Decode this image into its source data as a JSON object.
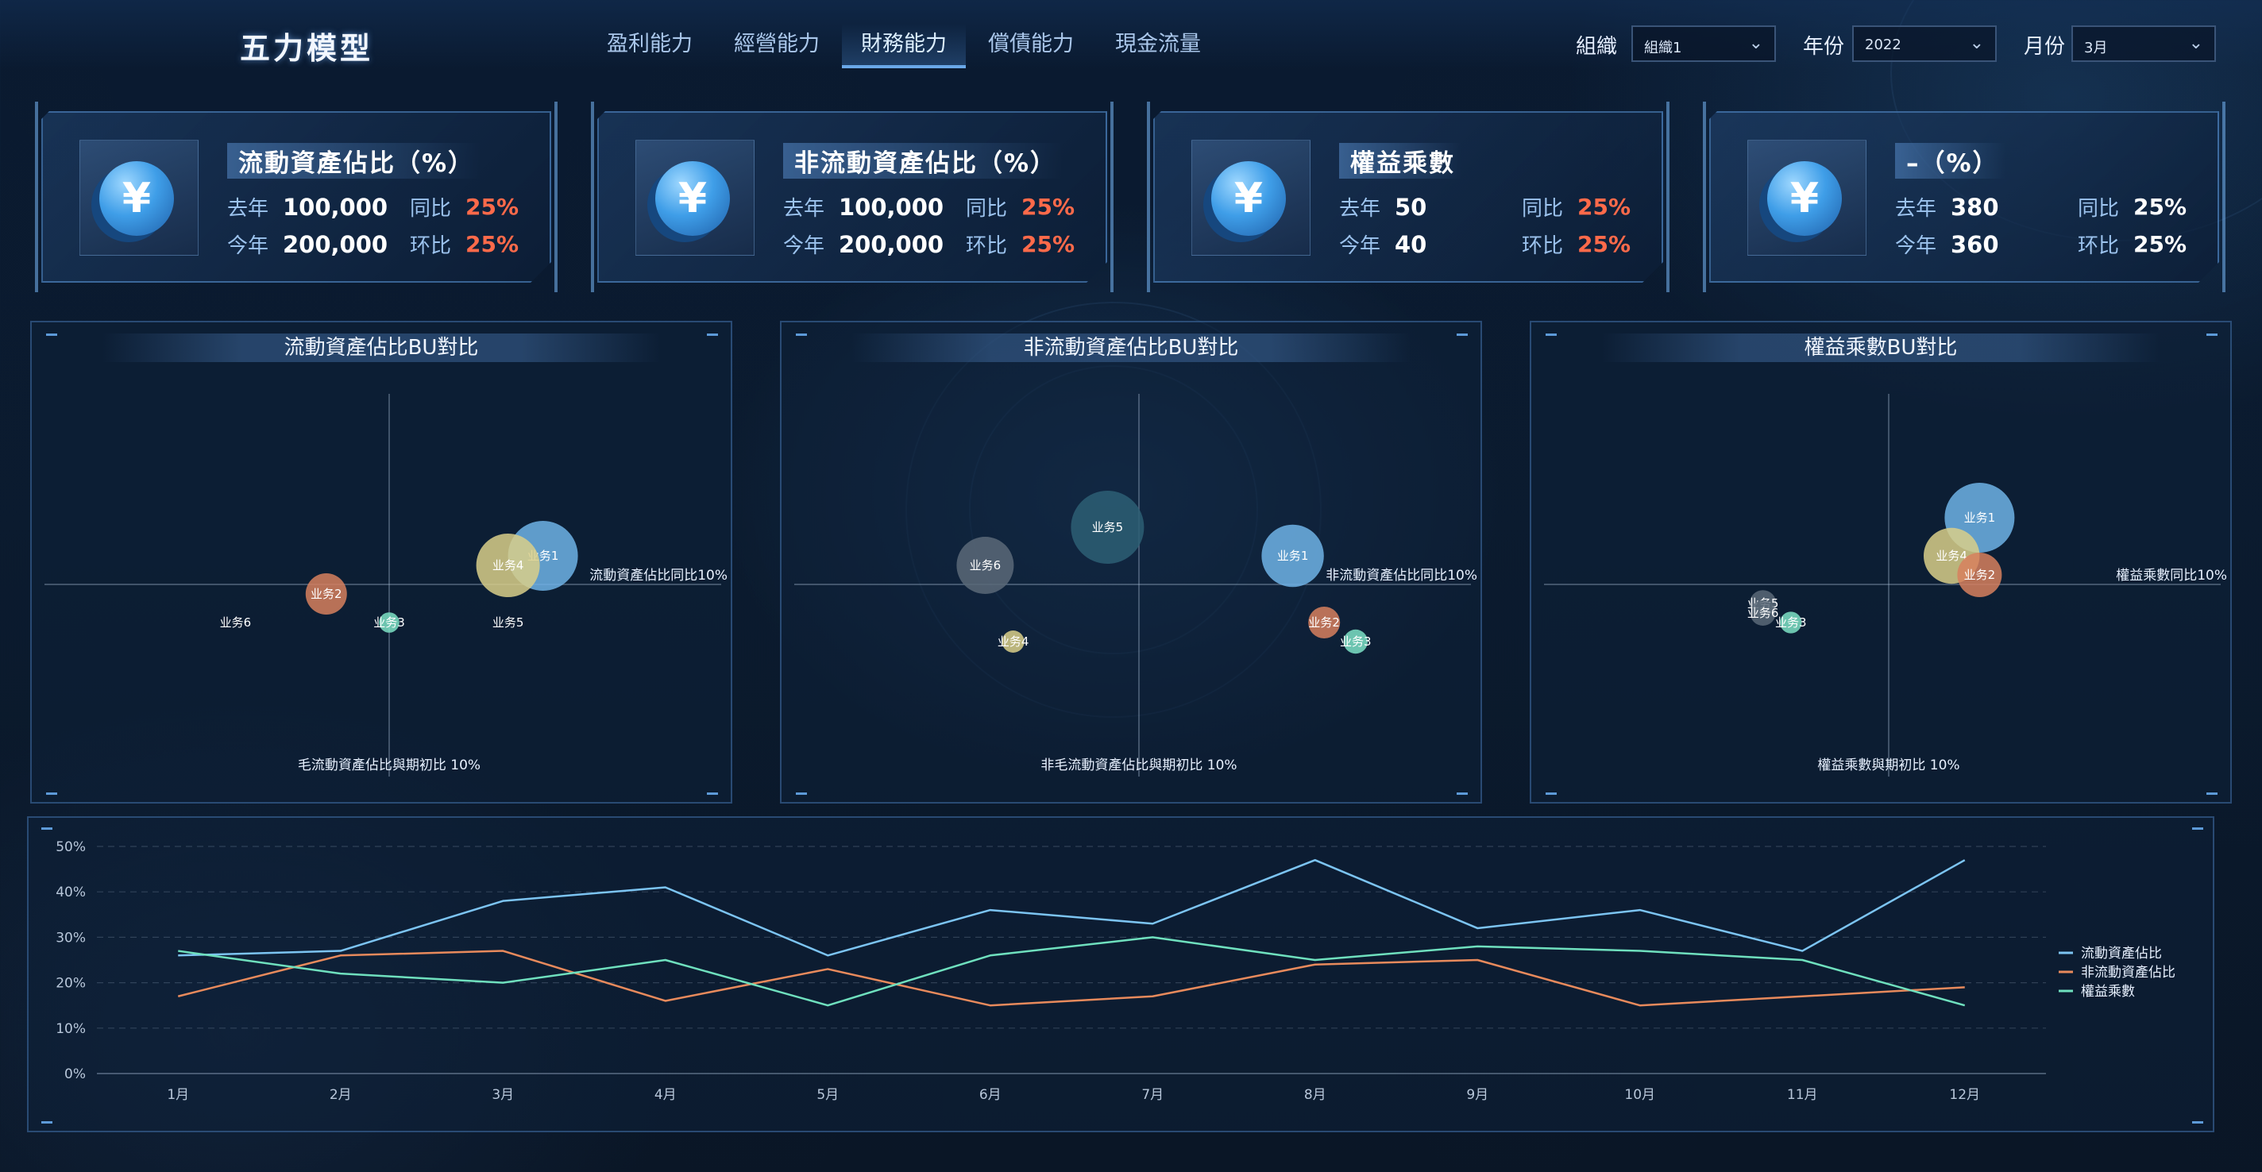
{
  "header": {
    "title": "五力模型",
    "nav": [
      "盈利能力",
      "經營能力",
      "財務能力",
      "償債能力",
      "現金流量"
    ],
    "active_nav": 2,
    "filters": {
      "org_label": "組織",
      "org_value": "組織1",
      "year_label": "年份",
      "year_value": "2022",
      "month_label": "月份",
      "month_value": "3月"
    }
  },
  "kpis": [
    {
      "title": "流動資產佔比（%）",
      "last_year_label": "去年",
      "last_year": "100,000",
      "this_year_label": "今年",
      "this_year": "200,000",
      "yoy_label": "同比",
      "yoy": "25%",
      "mom_label": "环比",
      "mom": "25%",
      "pct_color": "#ff6a4a",
      "icon": "yen-coin-icon"
    },
    {
      "title": "非流動資產佔比（%）",
      "last_year_label": "去年",
      "last_year": "100,000",
      "this_year_label": "今年",
      "this_year": "200,000",
      "yoy_label": "同比",
      "yoy": "25%",
      "mom_label": "环比",
      "mom": "25%",
      "pct_color": "#ff6a4a",
      "icon": "yen-coin-icon"
    },
    {
      "title": "權益乘數",
      "last_year_label": "去年",
      "last_year": "50",
      "this_year_label": "今年",
      "this_year": "40",
      "yoy_label": "同比",
      "yoy": "25%",
      "mom_label": "环比",
      "mom": "25%",
      "pct_color": "#ff6a4a",
      "icon": "yen-coin-icon"
    },
    {
      "title": "–（%）",
      "last_year_label": "去年",
      "last_year": "380",
      "this_year_label": "今年",
      "this_year": "360",
      "yoy_label": "同比",
      "yoy": "25%",
      "mom_label": "环比",
      "mom": "25%",
      "pct_color": "#ffffff",
      "icon": "yen-coin-icon"
    }
  ],
  "colors": {
    "blue": "#6fb3e6",
    "yellow": "#d9cf8a",
    "orange": "#d7805e",
    "teal": "#7ee2c6",
    "slate": "#5a6878",
    "darkteal": "#2d5f74",
    "line_blue": "#7cc4f2",
    "line_orange": "#e88a5c",
    "line_teal": "#6fe0be"
  },
  "chart_data": [
    {
      "type": "scatter",
      "title": "流動資產佔比BU對比",
      "xlabel": "毛流動資產佔比與期初比",
      "ylabel": "流動資產佔比同比",
      "axis_value_label": "10%",
      "points": [
        {
          "name": "业务1",
          "x": 0.44,
          "y": 0.12,
          "size": 0.9,
          "color": "#6fb3e6"
        },
        {
          "name": "业务4",
          "x": 0.34,
          "y": 0.08,
          "size": 0.8,
          "color": "#d9cf8a"
        },
        {
          "name": "业务2",
          "x": -0.18,
          "y": -0.04,
          "size": 0.45,
          "color": "#d7805e"
        },
        {
          "name": "业务3",
          "x": 0.0,
          "y": -0.16,
          "size": 0.12,
          "color": "#7ee2c6"
        },
        {
          "name": "业务6",
          "x": -0.44,
          "y": -0.16,
          "size": 0.0,
          "color": "#ffffff"
        },
        {
          "name": "业务5",
          "x": 0.34,
          "y": -0.16,
          "size": 0.0,
          "color": "#ffffff"
        }
      ]
    },
    {
      "type": "scatter",
      "title": "非流動資產佔比BU對比",
      "xlabel": "非毛流動資產佔比與期初比",
      "ylabel": "非流動資產佔比同比",
      "axis_value_label": "10%",
      "points": [
        {
          "name": "业务5",
          "x": -0.09,
          "y": 0.24,
          "size": 0.95,
          "color": "#2d5f74"
        },
        {
          "name": "业务6",
          "x": -0.44,
          "y": 0.08,
          "size": 0.7,
          "color": "#5a6878"
        },
        {
          "name": "业务1",
          "x": 0.44,
          "y": 0.12,
          "size": 0.78,
          "color": "#6fb3e6"
        },
        {
          "name": "业务2",
          "x": 0.53,
          "y": -0.16,
          "size": 0.3,
          "color": "#d7805e"
        },
        {
          "name": "业务3",
          "x": 0.62,
          "y": -0.24,
          "size": 0.18,
          "color": "#7ee2c6"
        },
        {
          "name": "业务4",
          "x": -0.36,
          "y": -0.24,
          "size": 0.15,
          "color": "#d9cf8a"
        }
      ]
    },
    {
      "type": "scatter",
      "title": "權益乘數BU對比",
      "xlabel": "權益乘數與期初比",
      "ylabel": "權益乘數同比",
      "axis_value_label": "10%",
      "points": [
        {
          "name": "业务1",
          "x": 0.26,
          "y": 0.28,
          "size": 0.9,
          "color": "#6fb3e6"
        },
        {
          "name": "业务4",
          "x": 0.18,
          "y": 0.12,
          "size": 0.68,
          "color": "#d9cf8a"
        },
        {
          "name": "业务2",
          "x": 0.26,
          "y": 0.04,
          "size": 0.5,
          "color": "#d7805e"
        },
        {
          "name": "业务5",
          "x": -0.36,
          "y": -0.08,
          "size": 0.22,
          "color": "#5a6878"
        },
        {
          "name": "业务6",
          "x": -0.36,
          "y": -0.12,
          "size": 0.2,
          "color": "#5a6878"
        },
        {
          "name": "业务3",
          "x": -0.28,
          "y": -0.16,
          "size": 0.14,
          "color": "#7ee2c6"
        }
      ]
    },
    {
      "type": "line",
      "categories": [
        "1月",
        "2月",
        "3月",
        "4月",
        "5月",
        "6月",
        "7月",
        "8月",
        "9月",
        "10月",
        "11月",
        "12月"
      ],
      "ylim": [
        0,
        50
      ],
      "yticks": [
        "0%",
        "10%",
        "20%",
        "30%",
        "40%",
        "50%"
      ],
      "series": [
        {
          "name": "流動資產佔比",
          "color": "#7cc4f2",
          "values": [
            26,
            27,
            38,
            41,
            26,
            36,
            33,
            47,
            32,
            36,
            27,
            47
          ]
        },
        {
          "name": "非流動資產佔比",
          "color": "#e88a5c",
          "values": [
            17,
            26,
            27,
            16,
            23,
            15,
            17,
            24,
            25,
            15,
            17,
            19
          ]
        },
        {
          "name": "權益乘數",
          "color": "#6fe0be",
          "values": [
            27,
            22,
            20,
            25,
            15,
            26,
            30,
            25,
            28,
            27,
            25,
            15
          ]
        }
      ]
    }
  ]
}
